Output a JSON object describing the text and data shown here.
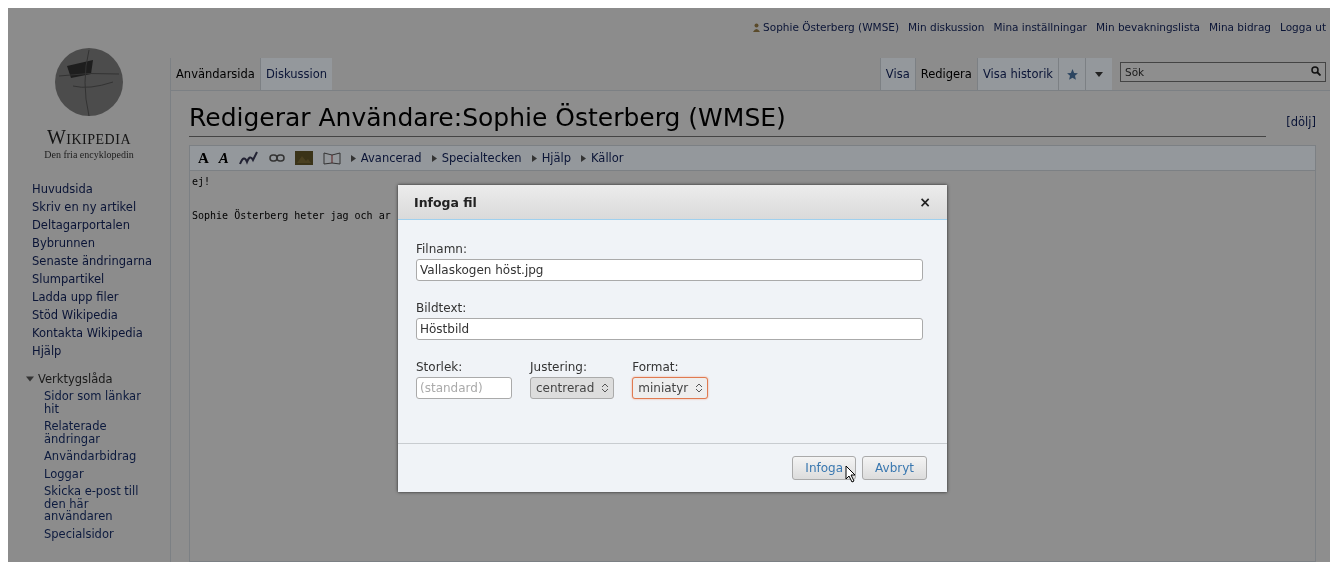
{
  "logo": {
    "wordmark": "Wikipedia",
    "tagline": "Den fria encyklopedin"
  },
  "personal_links": [
    "Sophie Österberg (WMSE)",
    "Min diskussion",
    "Mina inställningar",
    "Min bevakningslista",
    "Mina bidrag",
    "Logga ut"
  ],
  "namespace_tabs": [
    {
      "label": "Användarsida",
      "selected": true
    },
    {
      "label": "Diskussion",
      "selected": false
    }
  ],
  "view_tabs": [
    {
      "label": "Visa",
      "selected": false
    },
    {
      "label": "Redigera",
      "selected": true
    },
    {
      "label": "Visa historik",
      "selected": false
    }
  ],
  "search": {
    "placeholder": "Sök"
  },
  "sidebar": {
    "items": [
      "Huvudsida",
      "Skriv en ny artikel",
      "Deltagarportalen",
      "Bybrunnen",
      "Senaste ändringarna",
      "Slumpartikel",
      "Ladda upp filer",
      "Stöd Wikipedia",
      "Kontakta Wikipedia",
      "Hjälp"
    ],
    "toolbox": {
      "title": "Verktygslåda",
      "expanded": true,
      "items": [
        "Sidor som länkar hit",
        "Relaterade ändringar",
        "Användarbidrag",
        "Loggar",
        "Skicka e-post till den här användaren",
        "Specialsidor"
      ]
    }
  },
  "page_title": "Redigerar Användare:Sophie Österberg (WMSE)",
  "hide_link": "[dölj]",
  "editor": {
    "format_buttons": [
      "A",
      "A"
    ],
    "sections": [
      "Avancerad",
      "Specialtecken",
      "Hjälp",
      "Källor"
    ],
    "paragraphs": [
      "ej!",
      "Sophie Österberg heter jag och ar"
    ]
  },
  "dialog": {
    "title": "Infoga fil",
    "close": "×",
    "fields": [
      {
        "label": "Filnamn:",
        "value": "Vallaskogen höst.jpg"
      },
      {
        "label": "Bildtext:",
        "value": "Höstbild"
      }
    ],
    "size": {
      "label": "Storlek:",
      "placeholder": "(standard)"
    },
    "selects": [
      {
        "label": "Justering:",
        "value": "centrerad",
        "focused": false
      },
      {
        "label": "Format:",
        "value": "miniatyr",
        "focused": true
      }
    ],
    "buttons": [
      "Infoga",
      "Avbryt"
    ]
  }
}
